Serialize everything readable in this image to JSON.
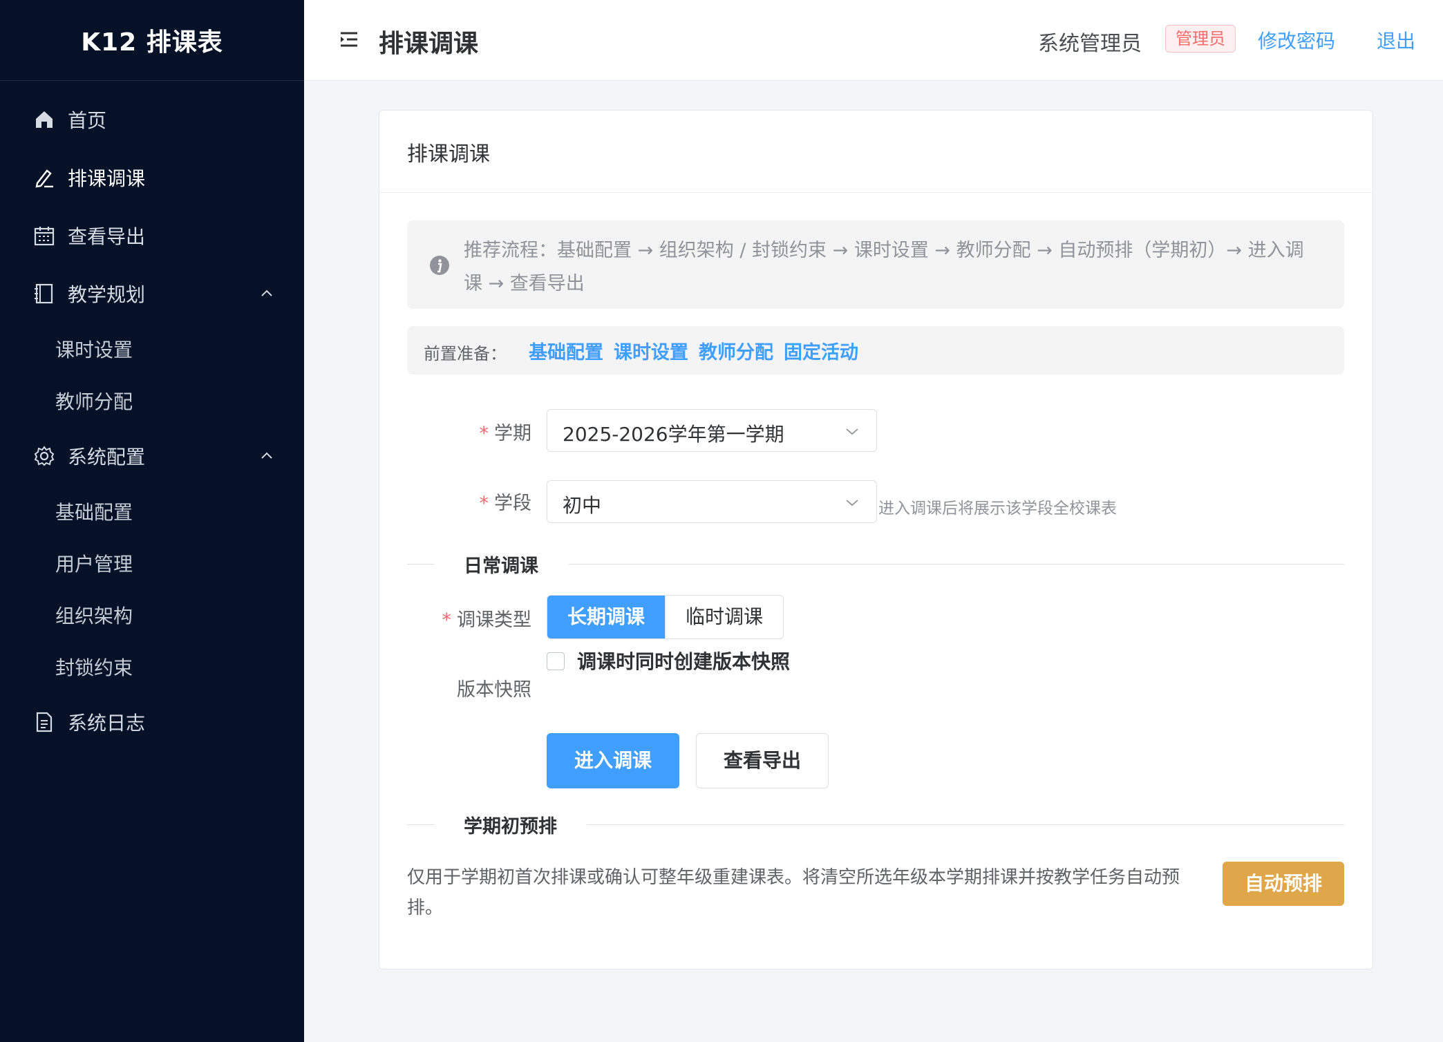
{
  "app": {
    "title": "K12 排课表"
  },
  "sidebar": {
    "items": [
      {
        "label": "首页",
        "icon": "home-icon"
      },
      {
        "label": "排课调课",
        "icon": "edit-pen-icon",
        "active": true
      },
      {
        "label": "查看导出",
        "icon": "calendar-icon"
      },
      {
        "label": "教学规划",
        "icon": "notebook-icon",
        "expanded": true,
        "children": [
          {
            "label": "课时设置"
          },
          {
            "label": "教师分配"
          }
        ]
      },
      {
        "label": "系统配置",
        "icon": "gear-icon",
        "expanded": true,
        "children": [
          {
            "label": "基础配置"
          },
          {
            "label": "用户管理"
          },
          {
            "label": "组织架构"
          },
          {
            "label": "封锁约束"
          }
        ]
      },
      {
        "label": "系统日志",
        "icon": "document-icon"
      }
    ]
  },
  "header": {
    "title": "排课调课",
    "user": "系统管理员",
    "role_badge": "管理员",
    "change_password": "修改密码",
    "logout": "退出"
  },
  "card": {
    "title": "排课调课",
    "info": "推荐流程：基础配置 → 组织架构 / 封锁约束 → 课时设置 → 教师分配 → 自动预排（学期初）→ 进入调课 → 查看导出",
    "prep": {
      "label": "前置准备：",
      "links": [
        "基础配置",
        "课时设置",
        "教师分配",
        "固定活动"
      ]
    },
    "term": {
      "label": "学期",
      "value": "2025-2026学年第一学期"
    },
    "stage": {
      "label": "学段",
      "value": "初中",
      "hint": "进入调课后将展示该学段全校课表"
    },
    "daily": {
      "section": "日常调课",
      "type_label": "调课类型",
      "type_options": [
        "长期调课",
        "临时调课"
      ],
      "type_selected": "长期调课",
      "snapshot_label": "版本快照",
      "snapshot_checkbox": "调课时同时创建版本快照",
      "snapshot_checked": false,
      "enter_button": "进入调课",
      "export_button": "查看导出"
    },
    "presched": {
      "section": "学期初预排",
      "desc": "仅用于学期初首次排课或确认可整年级重建课表。将清空所选年级本学期排课并按教学任务自动预排。",
      "button": "自动预排"
    }
  },
  "colors": {
    "sidebar_bg": "#041127",
    "primary": "#409eff",
    "danger": "#f56c6c",
    "warning": "#e0a64a"
  }
}
